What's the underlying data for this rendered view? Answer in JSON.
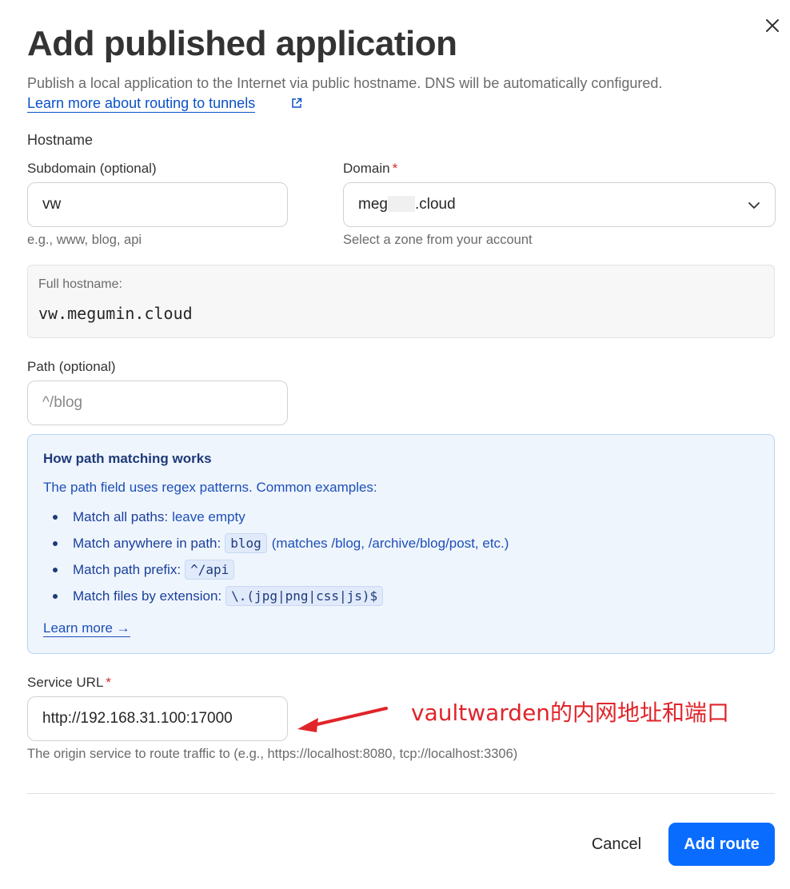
{
  "dialog": {
    "title": "Add published application",
    "description": "Publish a local application to the Internet via public hostname. DNS will be automatically configured.",
    "learn_link": "Learn more about routing to tunnels"
  },
  "hostname": {
    "section_label": "Hostname",
    "subdomain": {
      "label": "Subdomain (optional)",
      "value": "vw",
      "hint": "e.g., www, blog, api"
    },
    "domain": {
      "label": "Domain",
      "required_mark": "*",
      "value_prefix": "meg",
      "value_suffix": ".cloud",
      "hint": "Select a zone from your account"
    },
    "full": {
      "label": "Full hostname:",
      "value": "vw.megumin.cloud"
    }
  },
  "path": {
    "label": "Path (optional)",
    "placeholder": "^/blog"
  },
  "info": {
    "title": "How path matching works",
    "intro": "The path field uses regex patterns. Common examples:",
    "items": [
      {
        "label": "Match all paths:",
        "code": "",
        "text": "leave empty"
      },
      {
        "label": "Match anywhere in path:",
        "code": "blog",
        "text": "(matches /blog, /archive/blog/post, etc.)"
      },
      {
        "label": "Match path prefix:",
        "code": "^/api",
        "text": ""
      },
      {
        "label": "Match files by extension:",
        "code": "\\.(jpg|png|css|js)$",
        "text": ""
      }
    ],
    "learn_more": "Learn more →"
  },
  "service": {
    "label": "Service URL",
    "required_mark": "*",
    "value": "http://192.168.31.100:17000",
    "hint": "The origin service to route traffic to (e.g., https://localhost:8080, tcp://localhost:3306)"
  },
  "annotation": {
    "text": "vaultwarden的内网地址和端口",
    "color": "#e0242a"
  },
  "footer": {
    "cancel": "Cancel",
    "submit": "Add route"
  },
  "colors": {
    "primary": "#0a6cff",
    "link": "#0a51c7",
    "info_bg": "#eff5fd"
  }
}
